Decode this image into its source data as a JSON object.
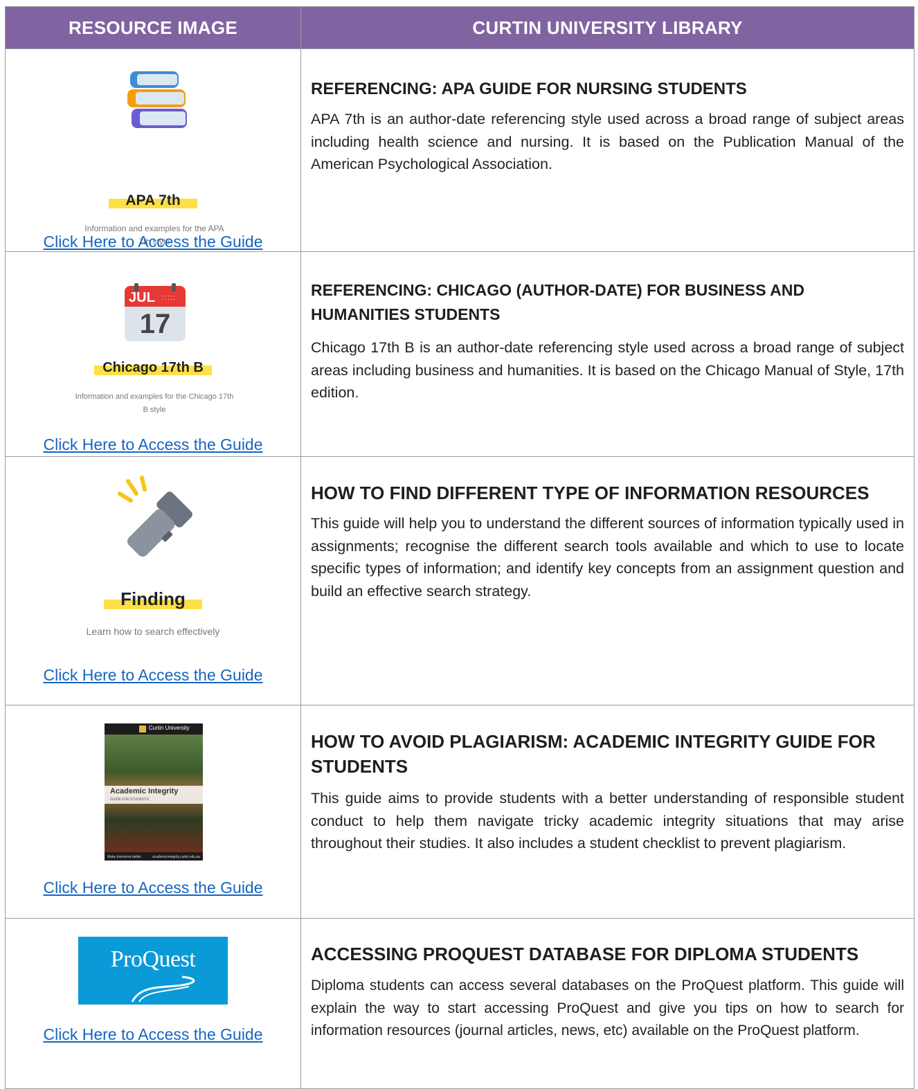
{
  "header": {
    "col1": "RESOURCE IMAGE",
    "col2": "CURTIN UNIVERSITY LIBRARY"
  },
  "link_label": "Click Here to Access the Guide",
  "rows": [
    {
      "thumb_title": "APA 7th",
      "thumb_sub": "Information and examples for the APA 7th style",
      "icon": "books-icon",
      "title": "REFERENCING: APA GUIDE FOR NURSING STUDENTS",
      "desc": "APA 7th is an author-date referencing style used across a broad range of subject areas including health science and nursing. It is based on the Publication Manual of the American Psychological Association."
    },
    {
      "thumb_title": "Chicago 17th B",
      "thumb_sub": "Information and examples for the Chicago 17th B style",
      "icon": "calendar-icon",
      "cal_month": "JUL",
      "cal_day": "17",
      "title": "REFERENCING: CHICAGO (AUTHOR-DATE) FOR BUSINESS AND HUMANITIES STUDENTS",
      "desc": "Chicago 17th B is an author-date referencing style used across a broad range of subject areas including business and humanities. It is based on the Chicago Manual of Style, 17th edition."
    },
    {
      "thumb_title": "Finding",
      "thumb_sub": "Learn how to search effectively",
      "icon": "flashlight-icon",
      "title": "HOW TO FIND DIFFERENT TYPE OF INFORMATION RESOURCES",
      "desc": "This guide will help you to understand the different sources of information typically used in assignments; recognise the different search tools available and which to use to locate specific types of information; and identify key concepts from an assignment question and build an effective search strategy."
    },
    {
      "cover_brand": "Curtin University",
      "cover_title": "Academic Integrity",
      "cover_sub": "GUIDE FOR STUDENTS",
      "cover_footer_left": "Make tomorrow better.",
      "cover_footer_right": "academicintegrity.curtin.edu.au",
      "icon": "guide-cover-image",
      "title": "HOW TO AVOID PLAGIARISM: ACADEMIC INTEGRITY GUIDE FOR STUDENTS",
      "desc": "This guide aims to provide students with a better understanding of responsible student conduct to help them navigate tricky academic integrity situations that may arise throughout their studies. It also includes a student checklist to prevent plagiarism."
    },
    {
      "logo_text": "ProQuest",
      "icon": "proquest-logo",
      "title": "ACCESSING PROQUEST DATABASE FOR DIPLOMA STUDENTS",
      "desc": "Diploma students can access several databases on the ProQuest platform. This guide will explain the way to start accessing ProQuest and give you tips on how to search for information resources (journal articles, news, etc) available on the ProQuest platform."
    }
  ],
  "colors": {
    "header_bg": "#8064a2",
    "link": "#1565c0",
    "highlight": "#fde047",
    "proquest_bg": "#0a9ad8"
  }
}
